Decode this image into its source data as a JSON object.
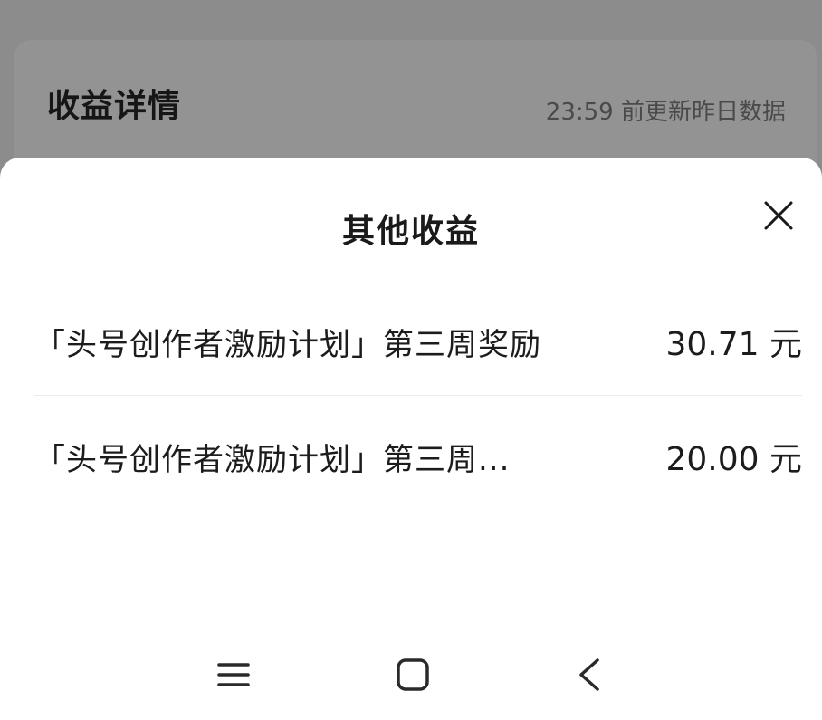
{
  "background": {
    "title": "收益详情",
    "update_note": "23:59 前更新昨日数据"
  },
  "sheet": {
    "title": "其他收益",
    "close_icon": "close-icon",
    "items": [
      {
        "label": "「头号创作者激励计划」第三周奖励",
        "amount": "30.71 元"
      },
      {
        "label": "「头号创作者激励计划」第三周...",
        "amount": "20.00 元"
      }
    ]
  },
  "navbar": {
    "icons": [
      "menu-icon",
      "home-icon",
      "back-icon"
    ]
  },
  "colors": {
    "overlay": "#8c8c8c",
    "sheet_background": "#ffffff",
    "text": "#1c1c1c"
  }
}
